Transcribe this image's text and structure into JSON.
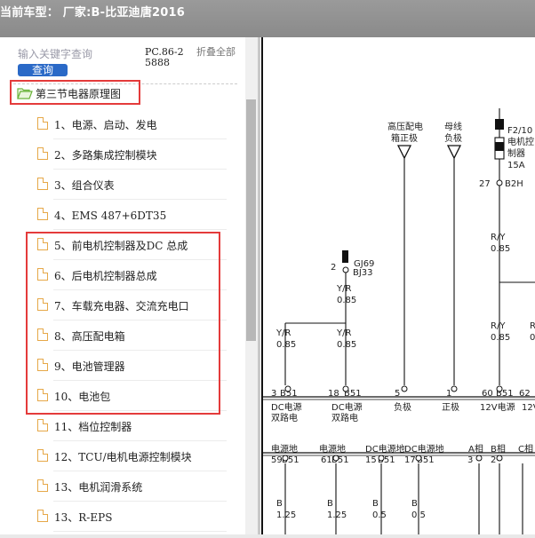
{
  "header": {
    "title": "当前车型： 厂家:B-比亚迪唐2016"
  },
  "sidebar": {
    "search_placeholder": "输入关键字查询",
    "search_button": "查询",
    "phone": "PC.86-25888",
    "collapse_label": "折叠全部",
    "root_label": "第三节电器原理图",
    "items": [
      {
        "label": "1、电源、启动、发电"
      },
      {
        "label": "2、多路集成控制模块"
      },
      {
        "label": "3、组合仪表"
      },
      {
        "label": "4、EMS 487+6DT35"
      },
      {
        "label": "5、前电机控制器及DC 总成"
      },
      {
        "label": "6、后电机控制器总成"
      },
      {
        "label": "7、车载充电器、交流充电口"
      },
      {
        "label": "8、高压配电箱"
      },
      {
        "label": "9、电池管理器"
      },
      {
        "label": "10、电池包"
      },
      {
        "label": "11、档位控制器"
      },
      {
        "label": "12、TCU/电机电源控制模块"
      },
      {
        "label": "13、电机润滑系统"
      },
      {
        "label": "13、R-EPS"
      }
    ]
  },
  "diagram": {
    "hv_box_label_1": "高压配电",
    "hv_box_label_2": "箱正极",
    "bus_label_1": "母线",
    "bus_label_2": "负极",
    "fuse_label_1": "F2/10",
    "fuse_label_2": "电机控",
    "fuse_label_3": "制器",
    "fuse_label_4": "15A",
    "pin_27": "27",
    "conn_b2h": "B2H",
    "wire_ry_top": "R/Y",
    "wire_085_top": "0.85",
    "pin_2": "2",
    "conn_gj69": "GJ69",
    "conn_bj33": "BJ33",
    "wire_yr_1": "Y/R",
    "wire_085_1": "0.85",
    "wire_yr_2": "Y/R",
    "wire_085_2": "0.85",
    "wire_yr_3": "Y/R",
    "wire_085_3": "0.85",
    "wire_ry_2": "R/Y",
    "wire_085_4": "0.85",
    "wire_r_right": "R",
    "wire_0_right": "0",
    "pin_3": "3",
    "pin_18": "18",
    "pin_5": "5",
    "pin_1": "1",
    "pin_60": "60",
    "pin_62": "62",
    "conn_b51": "B51",
    "dc_power_1": "DC电源",
    "dc_power_2": "双路电",
    "negative": "负极",
    "positive": "正极",
    "v12_power": "12V电源",
    "v12_2": "12V",
    "gnd_power": "电源地",
    "gnd_power_2": "电源地",
    "dc_gnd": "DC电源地",
    "dc_gnd_2": "DC电源地",
    "a_phase": "A相",
    "b_phase": "B相",
    "c_phase": "C相",
    "pin_59": "59",
    "pin_61": "61",
    "pin_15": "15",
    "pin_17": "17",
    "pin_3b": "3",
    "pin_2b": "2",
    "wire_b_1": "B",
    "wire_125_1": "1.25",
    "wire_b_2": "B",
    "wire_125_2": "1.25",
    "wire_b_3": "B",
    "wire_05_1": "0.5",
    "wire_b_4": "B",
    "wire_05_2": "0.5"
  }
}
